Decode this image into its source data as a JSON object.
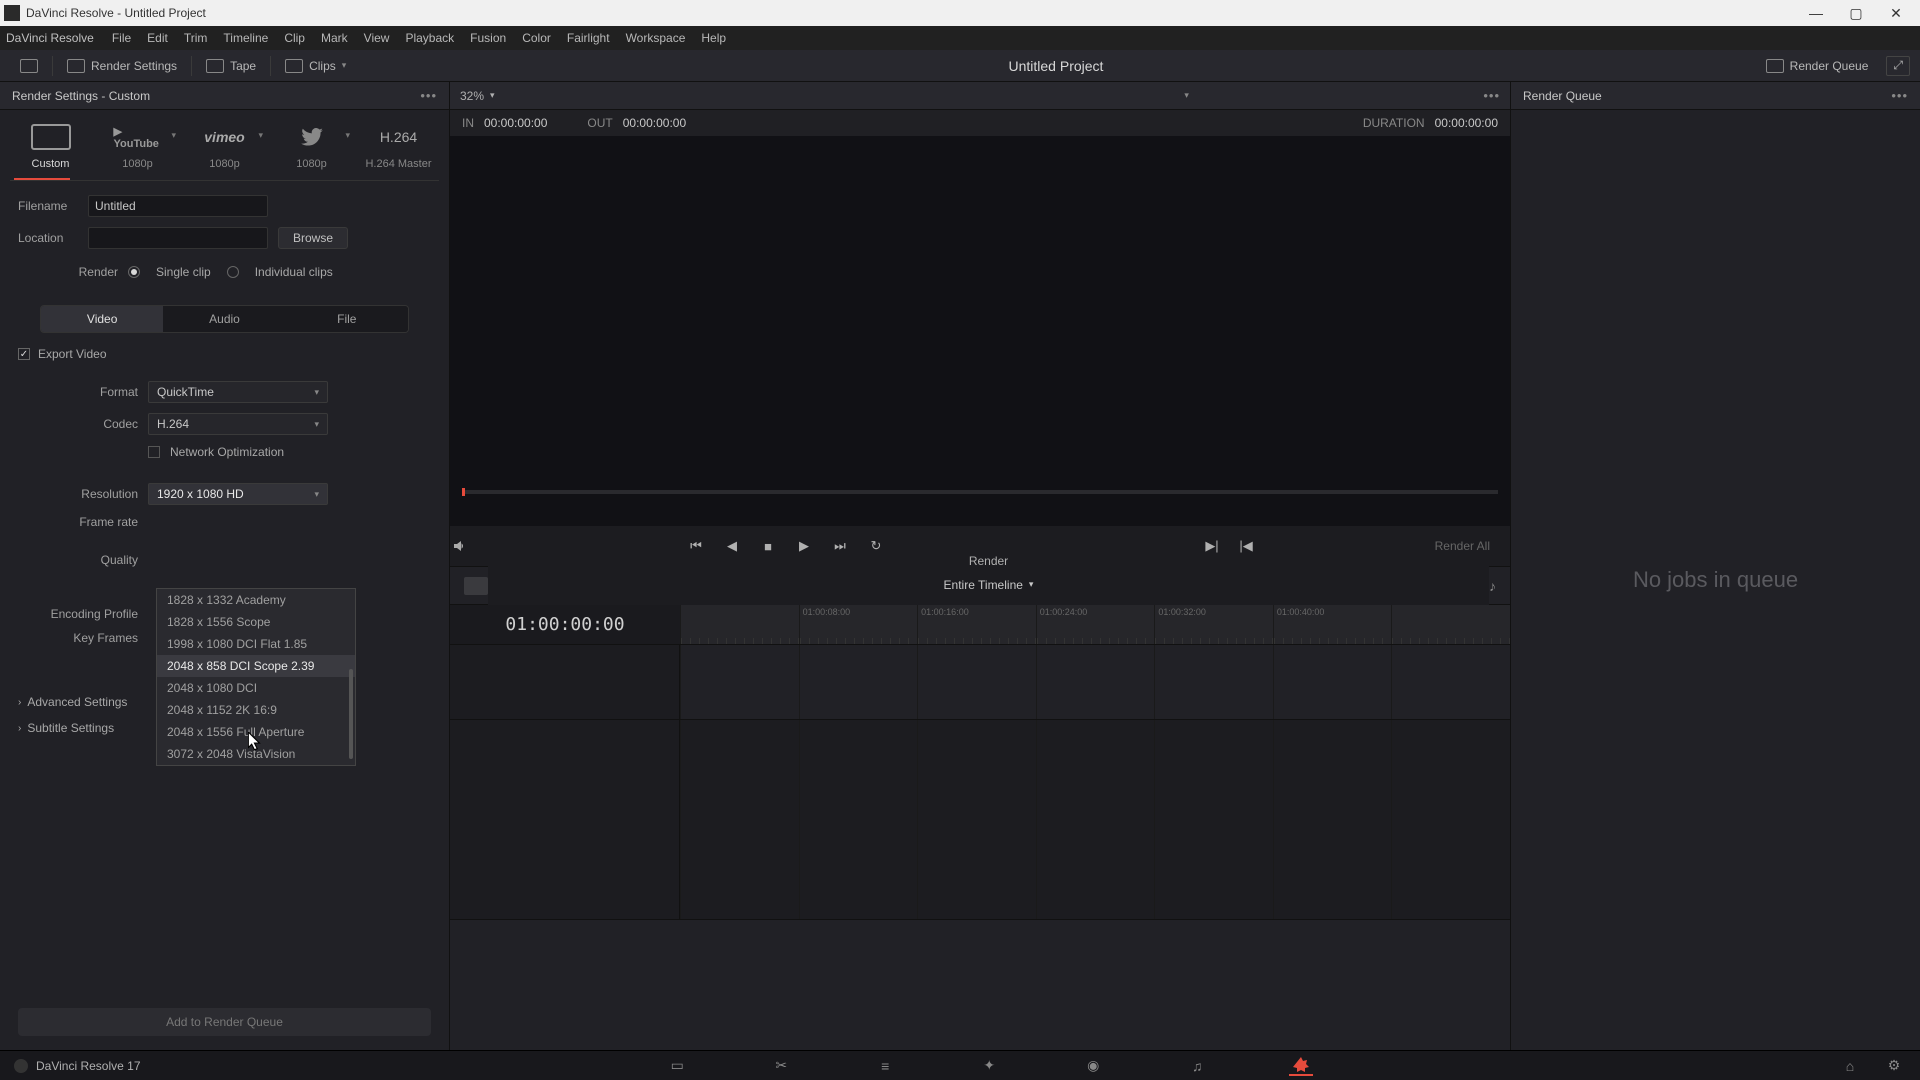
{
  "titlebar": {
    "text": "DaVinci Resolve - Untitled Project"
  },
  "menubar": {
    "logo": "DaVinci Resolve",
    "items": [
      "File",
      "Edit",
      "Trim",
      "Timeline",
      "Clip",
      "Mark",
      "View",
      "Playback",
      "Fusion",
      "Color",
      "Fairlight",
      "Workspace",
      "Help"
    ]
  },
  "toolbar": {
    "render_settings": "Render Settings",
    "tape": "Tape",
    "clips": "Clips",
    "project_title": "Untitled Project",
    "render_queue": "Render Queue"
  },
  "left": {
    "panel_title": "Render Settings - Custom",
    "presets": [
      {
        "label": "Custom",
        "icon": "custom"
      },
      {
        "label": "1080p",
        "brand": "YouTube"
      },
      {
        "label": "1080p",
        "brand": "vimeo"
      },
      {
        "label": "1080p",
        "brand": "twitter"
      },
      {
        "label": "H.264 Master",
        "brand": "H.264"
      }
    ],
    "filename_label": "Filename",
    "filename_value": "Untitled",
    "location_label": "Location",
    "location_value": "",
    "browse": "Browse",
    "render_label": "Render",
    "single_clip": "Single clip",
    "individual_clips": "Individual clips",
    "tabs": [
      "Video",
      "Audio",
      "File"
    ],
    "export_video": "Export Video",
    "format_label": "Format",
    "format_value": "QuickTime",
    "codec_label": "Codec",
    "codec_value": "H.264",
    "netopt": "Network Optimization",
    "resolution_label": "Resolution",
    "resolution_value": "1920 x 1080 HD",
    "framerate_label": "Frame rate",
    "quality_label": "Quality",
    "encoding_label": "Encoding Profile",
    "keyframes_label": "Key Frames",
    "dropdown": [
      "1828 x 1332 Academy",
      "1828 x 1556 Scope",
      "1998 x 1080 DCI Flat 1.85",
      "2048 x 858 DCI Scope 2.39",
      "2048 x 1080 DCI",
      "2048 x 1152 2K 16:9",
      "2048 x 1556 Full Aperture",
      "3072 x 2048 VistaVision"
    ],
    "advanced": "Advanced Settings",
    "subtitle": "Subtitle Settings",
    "add_queue": "Add to Render Queue"
  },
  "viewer": {
    "zoom": "32%",
    "in_label": "IN",
    "in_tc": "00:00:00:00",
    "out_label": "OUT",
    "out_tc": "00:00:00:00",
    "dur_label": "DURATION",
    "dur_tc": "00:00:00:00",
    "render_all": "Render All"
  },
  "timeline": {
    "render_label": "Render",
    "scope": "Entire Timeline",
    "start_tc": "01:00:00:00",
    "ticks": [
      "",
      "01:00:08:00",
      "01:00:16:00",
      "01:00:24:00",
      "01:00:32:00",
      "01:00:40:00",
      ""
    ]
  },
  "right": {
    "title": "Render Queue",
    "empty": "No jobs in queue"
  },
  "bottombar": {
    "app": "DaVinci Resolve 17"
  }
}
